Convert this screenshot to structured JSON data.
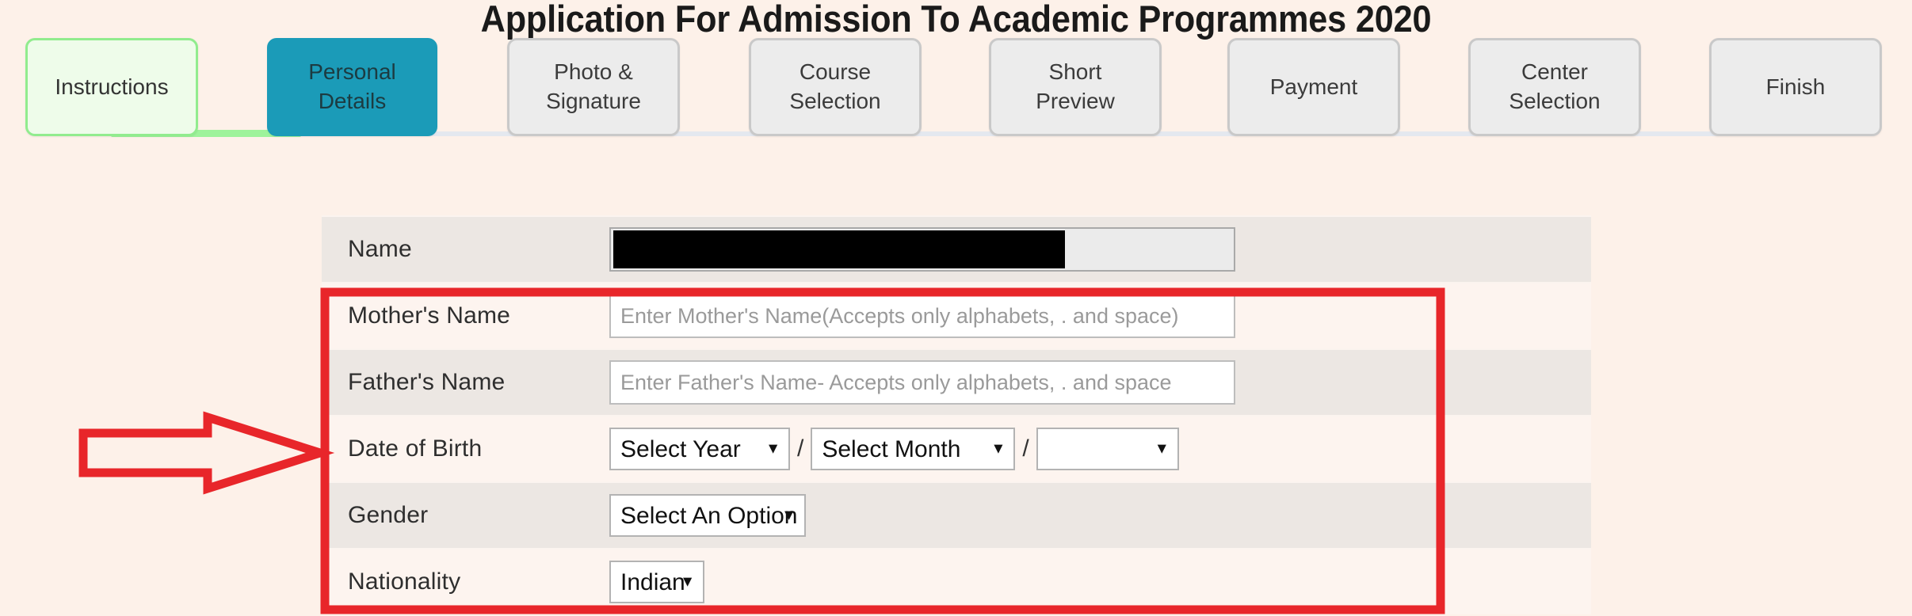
{
  "page": {
    "title": "Application For Admission To Academic Programmes 2020",
    "background_color": "#fdf1e9"
  },
  "wizard": {
    "active_color": "#1b9bb8",
    "done_color": "#91ec8e",
    "steps": [
      {
        "label": "Instructions",
        "state": "done",
        "lines": [
          "Instructions"
        ]
      },
      {
        "label": "Personal Details",
        "state": "active",
        "lines": [
          "Personal",
          "Details"
        ]
      },
      {
        "label": "Photo & Signature",
        "state": "inactive",
        "lines": [
          "Photo &",
          "Signature"
        ]
      },
      {
        "label": "Course Selection",
        "state": "inactive",
        "lines": [
          "Course",
          "Selection"
        ]
      },
      {
        "label": "Short Preview",
        "state": "inactive",
        "lines": [
          "Short",
          "Preview"
        ]
      },
      {
        "label": "Payment",
        "state": "inactive",
        "lines": [
          "Payment"
        ]
      },
      {
        "label": "Center Selection",
        "state": "inactive",
        "lines": [
          "Center",
          "Selection"
        ]
      },
      {
        "label": "Finish",
        "state": "inactive",
        "lines": [
          "Finish"
        ]
      }
    ]
  },
  "form": {
    "rows": {
      "name": {
        "label": "Name",
        "value": "",
        "redacted": true
      },
      "mother": {
        "label": "Mother's Name",
        "value": "",
        "placeholder": "Enter Mother's Name(Accepts only alphabets, . and space)"
      },
      "father": {
        "label": "Father's Name",
        "value": "",
        "placeholder": "Enter Father's Name- Accepts only alphabets, . and space"
      },
      "dob": {
        "label": "Date of Birth",
        "year_value": "Select Year",
        "month_value": "Select Month",
        "day_value": "",
        "separator": "/"
      },
      "gender": {
        "label": "Gender",
        "value": "Select An Option"
      },
      "nationality": {
        "label": "Nationality",
        "value": "Indian"
      }
    }
  },
  "annotations": {
    "highlight_color": "#e8262a",
    "arrow": {
      "name": "red-right-arrow",
      "direction": "right"
    },
    "box": {
      "name": "red-highlight-box"
    }
  }
}
